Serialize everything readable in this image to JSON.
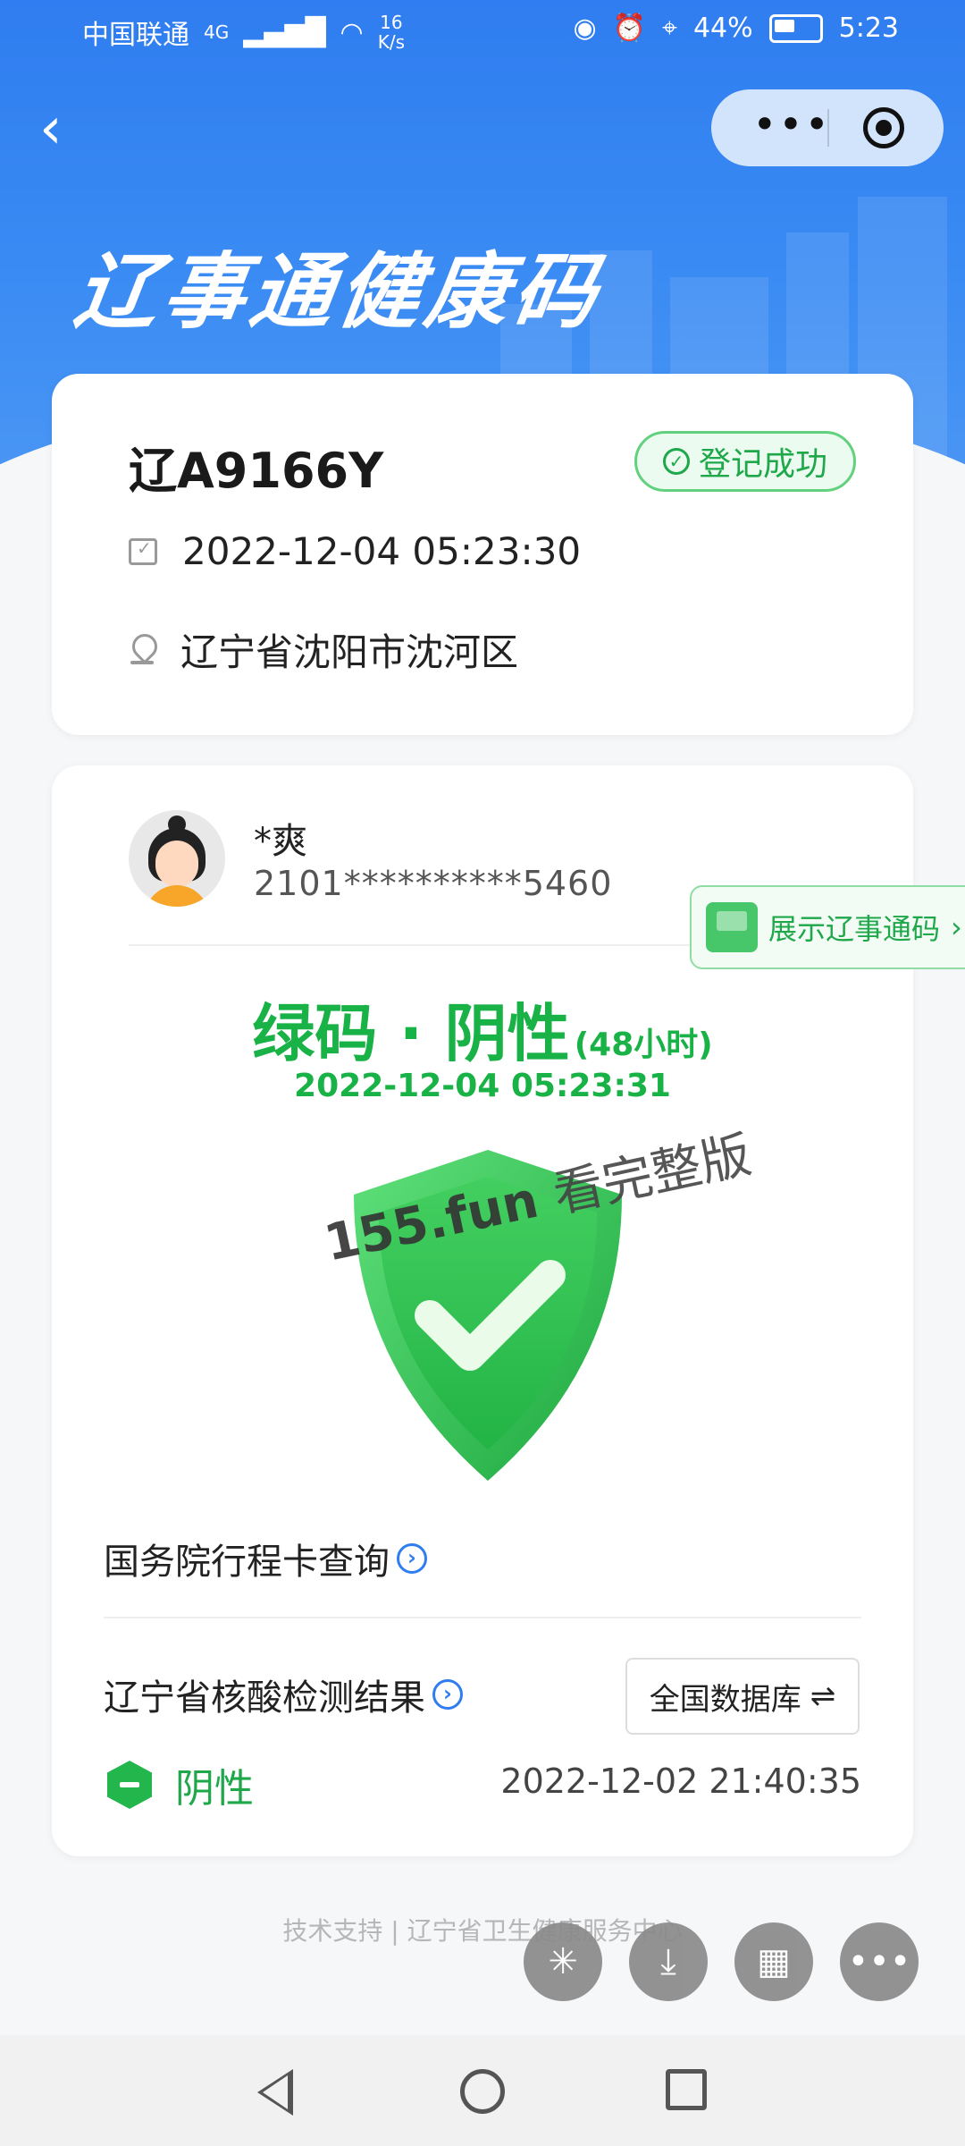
{
  "status_bar": {
    "carrier": "中国联通",
    "network": "4G",
    "speed_value": "16",
    "speed_unit": "K/s",
    "battery": "44%",
    "time": "5:23"
  },
  "header": {
    "title": "辽事通健康码",
    "menu_dots": "•••"
  },
  "vehicle_card": {
    "plate": "辽A9166Y",
    "badge": "登记成功",
    "datetime": "2022-12-04 05:23:30",
    "location": "辽宁省沈阳市沈河区"
  },
  "person": {
    "name": "*爽",
    "id_masked": "2101**********5460"
  },
  "side_button": {
    "label": "展示辽事通码"
  },
  "health_status": {
    "status": "绿码 · 阴性",
    "window": "(48小时)",
    "timestamp": "2022-12-04 05:23:31",
    "color": "#18b246"
  },
  "watermark": {
    "site": "155.fun",
    "text": "看完整版"
  },
  "links": {
    "itinerary": "国务院行程卡查询",
    "nucleic": "辽宁省核酸检测结果",
    "database_button": "全国数据库",
    "database_icon": "⇌"
  },
  "nucleic_result": {
    "label": "阴性",
    "time": "2022-12-02 21:40:35"
  },
  "footer": {
    "text": "技术支持 | 辽宁省卫生健康服务中心"
  },
  "fab_icons": [
    "spark-icon",
    "download-icon",
    "grid-icon",
    "more-icon"
  ],
  "colors": {
    "brand_blue": "#2f7df0",
    "green": "#18b246"
  }
}
